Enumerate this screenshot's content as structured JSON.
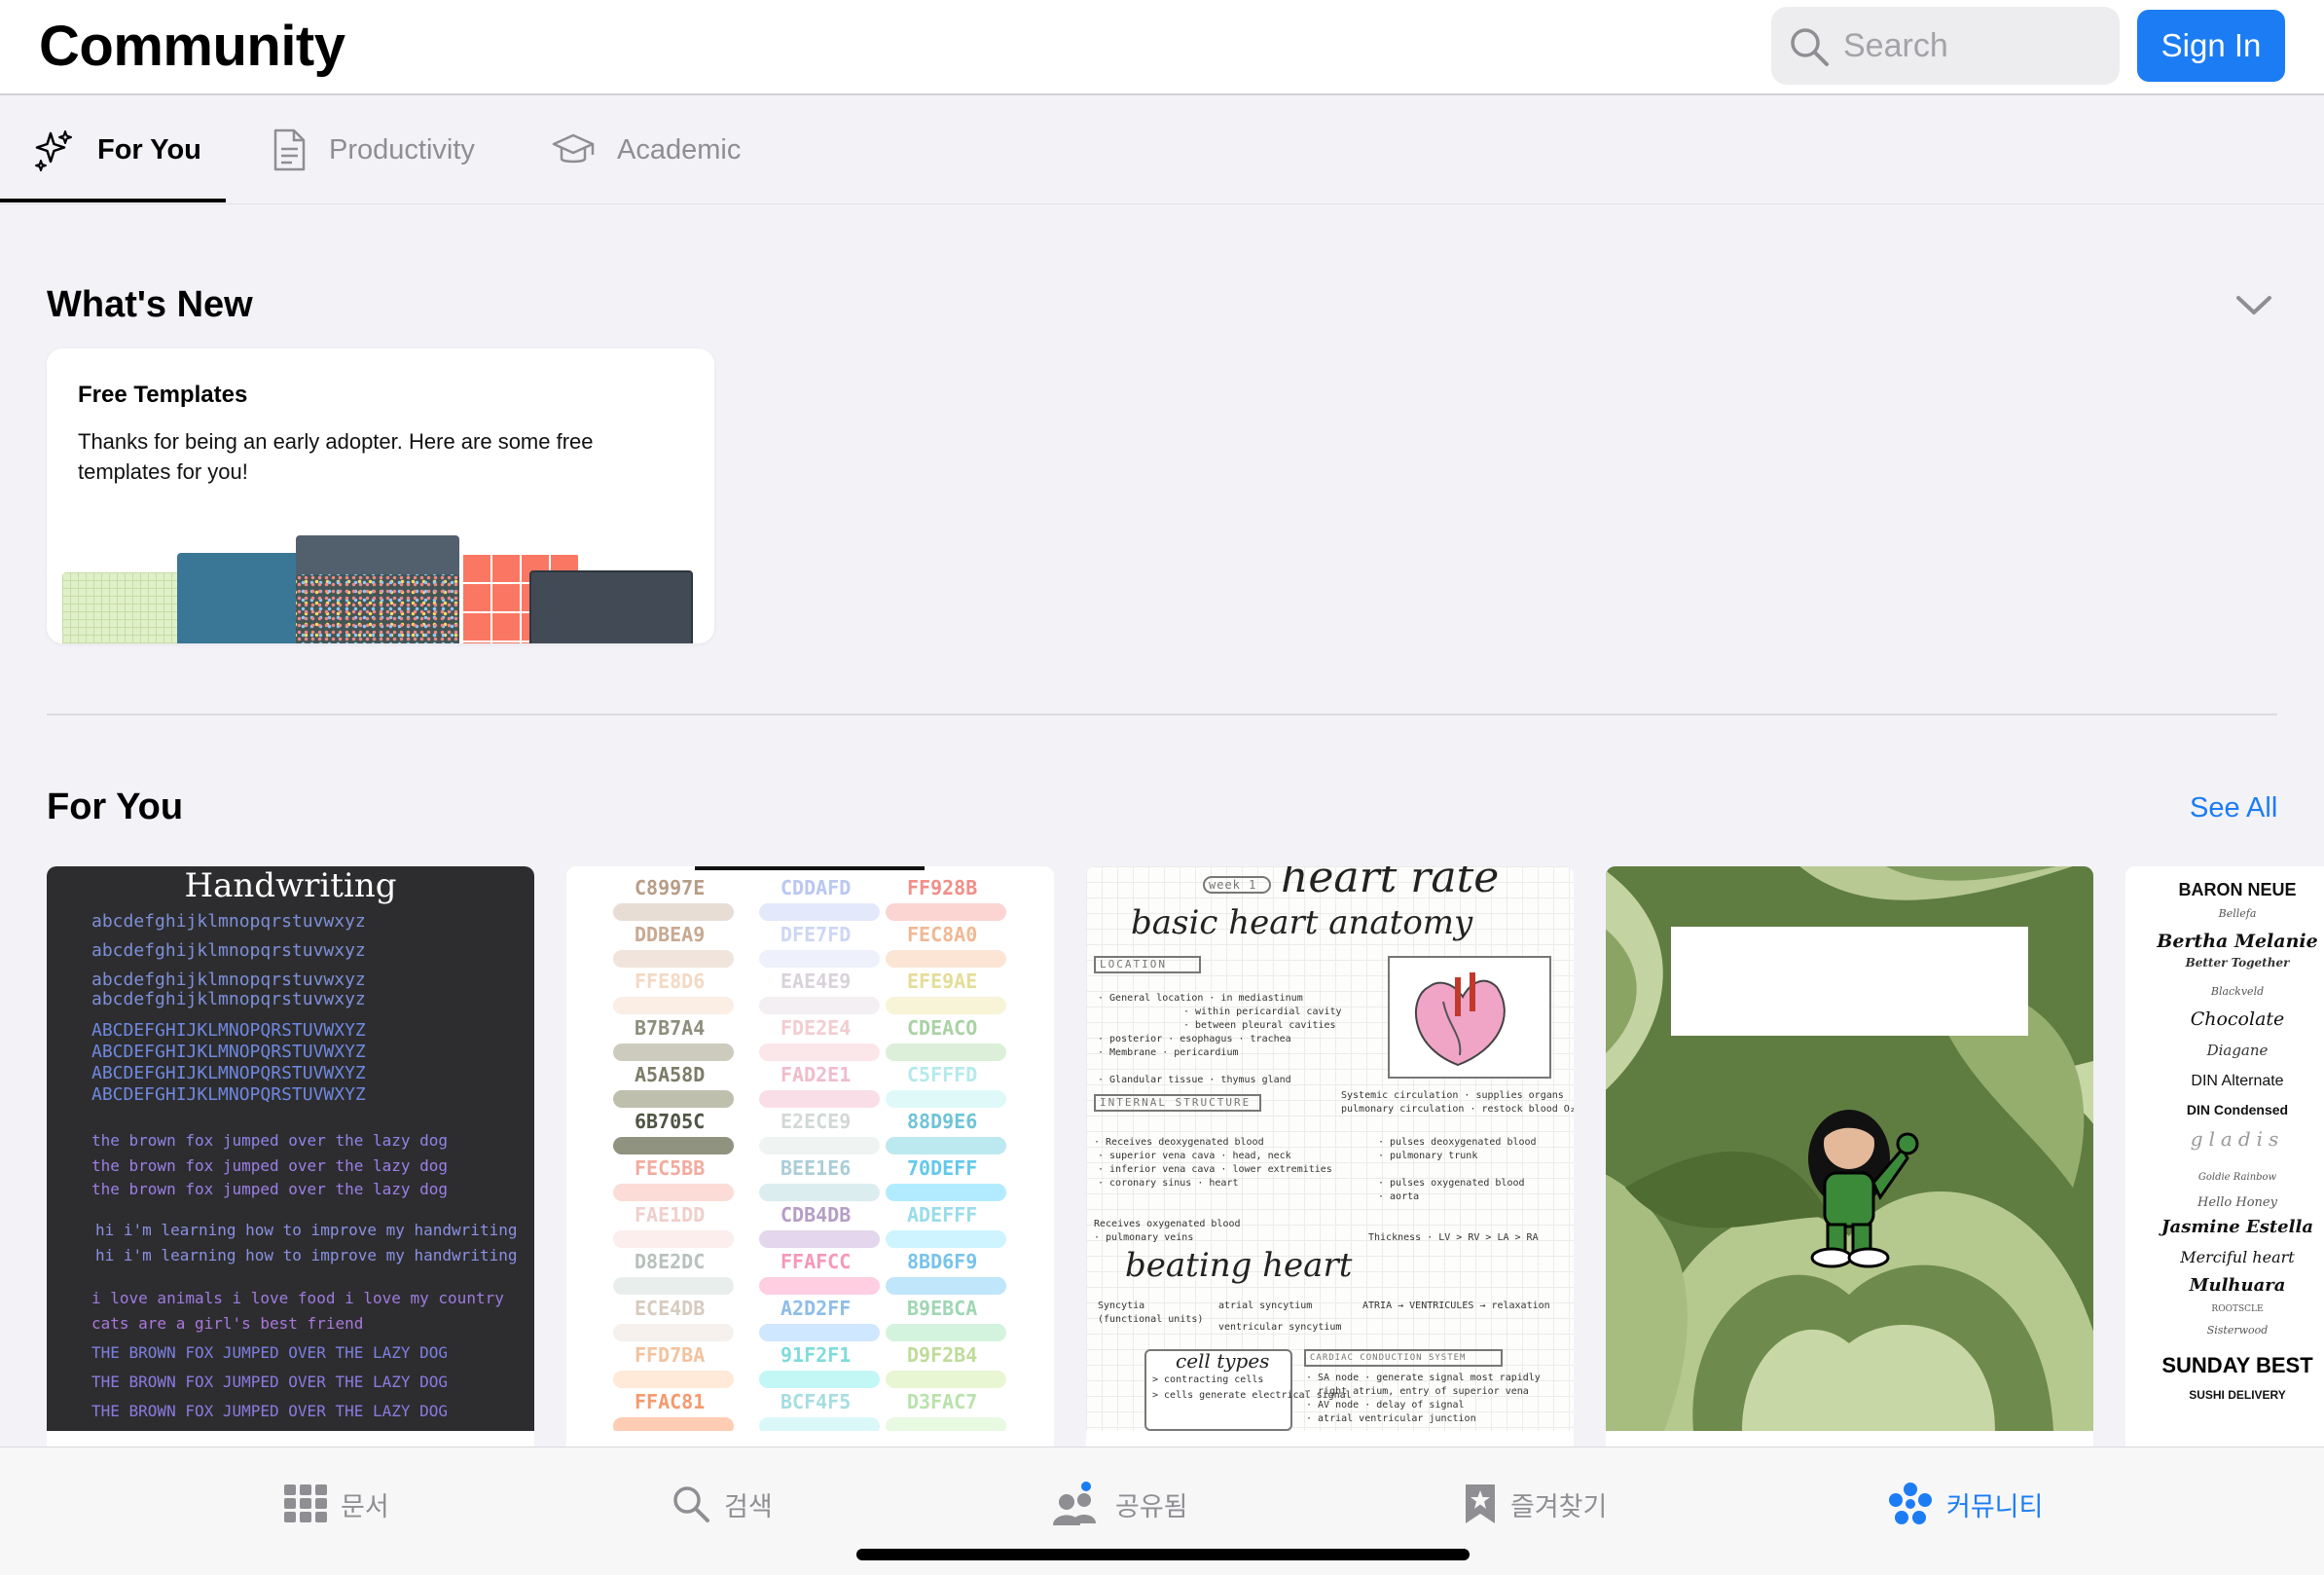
{
  "header": {
    "title": "Community",
    "search_placeholder": "Search",
    "signin_label": "Sign In"
  },
  "tabs": [
    {
      "label": "For You",
      "icon": "sparkles-icon",
      "active": true
    },
    {
      "label": "Productivity",
      "icon": "document-icon",
      "active": false
    },
    {
      "label": "Academic",
      "icon": "graduation-cap-icon",
      "active": false
    }
  ],
  "whats_new": {
    "title": "What's New",
    "card": {
      "title": "Free Templates",
      "body": "Thanks for being an early adopter. Here are some free templates for you!"
    }
  },
  "for_you": {
    "title": "For You",
    "see_all": "See All",
    "handwriting": {
      "title": "Handwriting",
      "lines": [
        "abcdefghijklmnopqrstuvwxyz",
        "abcdefghijklmnopqrstuvwxyz",
        "abcdefghijklmnopqrstuvwxyz",
        "abcdefghijklmnopqrstuvwxyz",
        "ABCDEFGHIJKLMNOPQRSTUVWXYZ",
        "ABCDEFGHIJKLMNOPQRSTUVWXYZ",
        "ABCDEFGHIJKLMNOPQRSTUVWXYZ",
        "ABCDEFGHIJKLMNOPQRSTUVWXYZ",
        "the brown fox jumped over the lazy dog",
        "the brown fox jumped over the lazy dog",
        "the brown fox jumped over the lazy dog",
        "hi i'm learning how to improve my handwriting",
        "hi i'm learning how to improve my handwriting",
        "i love animals i love food i love my country",
        "cats are a girl's best friend",
        "THE BROWN FOX JUMPED OVER THE LAZY DOG",
        "THE BROWN FOX JUMPED OVER THE LAZY DOG",
        "THE BROWN FOX JUMPED OVER THE LAZY DOG"
      ]
    },
    "colors": {
      "labels": [
        "C8997E",
        "CDDAFD",
        "FF928B",
        "DDBEA9",
        "DFE7FD",
        "FEC8A0",
        "FFE8D6",
        "EAE4E9",
        "EFE9AE",
        "B7B7A4",
        "FDE2E4",
        "CDEACO",
        "A5A58D",
        "FAD2E1",
        "C5FFFD",
        "6B705C",
        "E2ECE9",
        "88D9E6",
        "FEC5BB",
        "BEE1E6",
        "70DEFF",
        "FAE1DD",
        "CDB4DB",
        "ADEFFF",
        "D8E2DC",
        "FFAFCC",
        "8BD6F9",
        "ECE4DB",
        "A2D2FF",
        "B9EBCA",
        "FFD7BA",
        "91F2F1",
        "D9F2B4",
        "FFAC81",
        "BCF4F5",
        "D3FAC7"
      ]
    },
    "notes": {
      "top_title": "heart rate",
      "week": "week 1",
      "heading1": "basic heart anatomy",
      "box1": "LOCATION",
      "box2": "INTERNAL STRUCTURE",
      "box3": "CARDIAC CONDUCTION SYSTEM",
      "heading2": "beating heart",
      "cell_types": "cell types"
    },
    "fonts": {
      "lines": [
        "BARON NEUE",
        "Bellefa",
        "Bertha Melanie",
        "Better Together",
        "Blackveld",
        "Chocolate",
        "Diagane",
        "DIN Alternate",
        "DIN Condensed",
        "gladis",
        "Goldie Rainbow",
        "Hello Honey",
        "Jasmine Estella",
        "Merciful heart",
        "Mulhuara",
        "ROOTSCLE",
        "Sisterwood",
        "SUNDAY BEST",
        "SUSHI DELIVERY"
      ]
    }
  },
  "tabbar": [
    {
      "label": "문서",
      "icon": "grid-icon",
      "active": false
    },
    {
      "label": "검색",
      "icon": "search-icon",
      "active": false
    },
    {
      "label": "공유됨",
      "icon": "people-icon",
      "active": false
    },
    {
      "label": "즐겨찾기",
      "icon": "bookmark-star-icon",
      "active": false
    },
    {
      "label": "커뮤니티",
      "icon": "community-icon",
      "active": true
    }
  ],
  "colors": {
    "accent": "#1c7cf4",
    "background": "#f2f2f7"
  }
}
